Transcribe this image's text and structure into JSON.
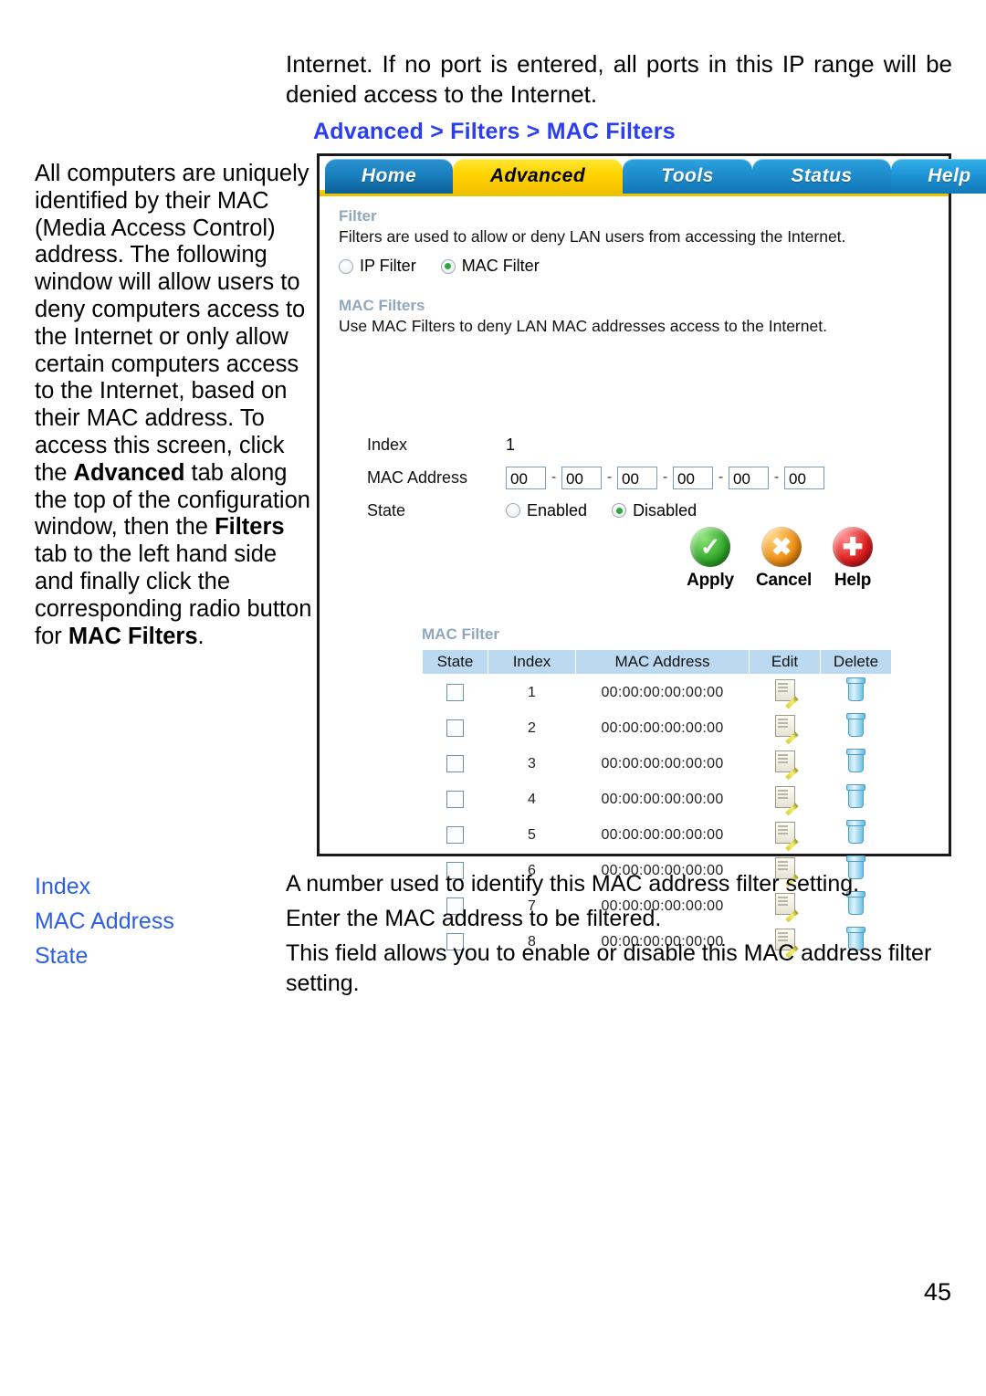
{
  "page": {
    "number": "45",
    "intro_paragraph": "Internet. If no port is entered, all ports in this IP range will be denied access to the Internet.",
    "breadcrumb": "Advanced > Filters > MAC Filters"
  },
  "left_column": {
    "text_part1": "All computers are uniquely identified by their MAC (Media Access Control) address. The following window will allow users to deny computers access to the Internet or only allow certain computers access to the Internet, based on their MAC address. To access this screen, click the ",
    "bold1": "Advanced",
    "text_part2": " tab along the top of the configuration window, then the ",
    "bold2": "Filters",
    "text_part3": " tab to the left hand side and finally click the corresponding radio button for ",
    "bold3": "MAC Filters",
    "text_part4": "."
  },
  "screenshot": {
    "tabs": [
      {
        "label": "Home",
        "active": false
      },
      {
        "label": "Advanced",
        "active": true
      },
      {
        "label": "Tools",
        "active": false
      },
      {
        "label": "Status",
        "active": false
      },
      {
        "label": "Help",
        "active": false
      }
    ],
    "filter_section": {
      "title": "Filter",
      "description": "Filters are used to allow or deny LAN users from accessing the Internet.",
      "options": [
        {
          "label": "IP Filter",
          "selected": false
        },
        {
          "label": "MAC Filter",
          "selected": true
        }
      ]
    },
    "mac_filters_section": {
      "title": "MAC Filters",
      "description": "Use MAC Filters to deny LAN MAC addresses access to the Internet."
    },
    "form": {
      "index_label": "Index",
      "index_value": "1",
      "mac_label": "MAC Address",
      "mac_octets": [
        "00",
        "00",
        "00",
        "00",
        "00",
        "00"
      ],
      "mac_separator": "-",
      "state_label": "State",
      "state_options": [
        {
          "label": "Enabled",
          "selected": false
        },
        {
          "label": "Disabled",
          "selected": true
        }
      ]
    },
    "actions": [
      {
        "label": "Apply",
        "icon": "check-circle-icon",
        "color": "#35ad2e"
      },
      {
        "label": "Cancel",
        "icon": "x-circle-icon",
        "color": "#f09216"
      },
      {
        "label": "Help",
        "icon": "plus-circle-icon",
        "color": "#e02020"
      }
    ],
    "list": {
      "title": "MAC Filter",
      "headers": [
        "State",
        "Index",
        "MAC Address",
        "Edit",
        "Delete"
      ],
      "rows": [
        {
          "state_checked": false,
          "index": "1",
          "mac": "00:00:00:00:00:00"
        },
        {
          "state_checked": false,
          "index": "2",
          "mac": "00:00:00:00:00:00"
        },
        {
          "state_checked": false,
          "index": "3",
          "mac": "00:00:00:00:00:00"
        },
        {
          "state_checked": false,
          "index": "4",
          "mac": "00:00:00:00:00:00"
        },
        {
          "state_checked": false,
          "index": "5",
          "mac": "00:00:00:00:00:00"
        },
        {
          "state_checked": false,
          "index": "6",
          "mac": "00:00:00:00:00:00"
        },
        {
          "state_checked": false,
          "index": "7",
          "mac": "00:00:00:00:00:00"
        },
        {
          "state_checked": false,
          "index": "8",
          "mac": "00:00:00:00:00:00"
        }
      ]
    }
  },
  "definitions": [
    {
      "term": "Index",
      "desc": "A number used to identify this MAC address filter setting."
    },
    {
      "term": "MAC Address",
      "desc": "Enter the MAC address to be filtered."
    },
    {
      "term": "State",
      "desc": "This field allows you to enable or disable this MAC address filter setting."
    }
  ]
}
